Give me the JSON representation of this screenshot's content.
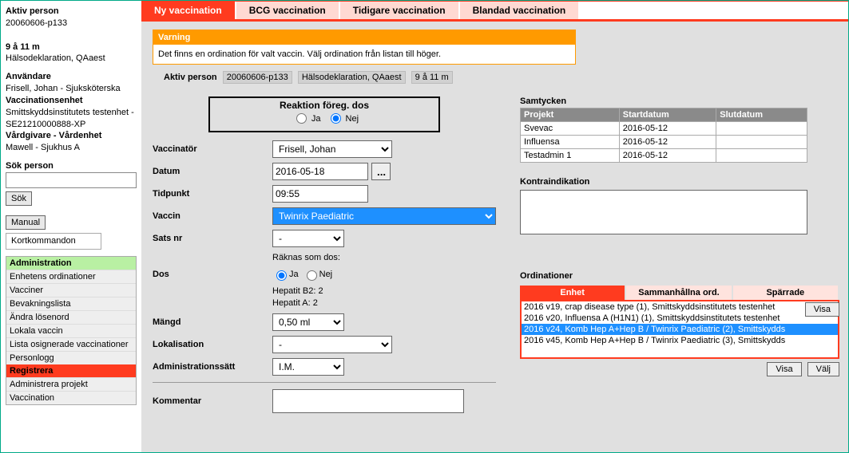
{
  "sidebar": {
    "active_person": {
      "label": "Aktiv person",
      "id": "20060606-p133",
      "age": "9 å 11 m",
      "name": "Hälsodeklaration, QAaest"
    },
    "user": {
      "label": "Användare",
      "name": "Frisell, Johan - Sjuksköterska"
    },
    "unit": {
      "label": "Vaccinationsenhet",
      "name": "Smittskyddsinstitutets testenhet - SE21210000888-XP"
    },
    "care": {
      "label": "Vårdgivare - Vårdenhet",
      "name": "Mawell - Sjukhus A"
    },
    "search": {
      "label": "Sök person",
      "button": "Sök"
    },
    "manual": "Manual",
    "shortcuts": "Kortkommandon"
  },
  "menu": {
    "admin": {
      "title": "Administration",
      "items": [
        "Enhetens ordinationer",
        "Vacciner",
        "Bevakningslista",
        "Ändra lösenord",
        "Lokala vaccin",
        "Lista osignerade vaccinationer",
        "Personlogg"
      ]
    },
    "register": {
      "title": "Registrera",
      "items": [
        "Administrera projekt",
        "Vaccination"
      ]
    }
  },
  "tabs": [
    "Ny vaccination",
    "BCG vaccination",
    "Tidigare vaccination",
    "Blandad vaccination"
  ],
  "warning": {
    "title": "Varning",
    "text": "Det finns en ordination för valt vaccin. Välj ordination från listan till höger."
  },
  "context": {
    "label": "Aktiv person",
    "id": "20060606-p133",
    "name": "Hälsodeklaration, QAaest",
    "age": "9 å 11 m"
  },
  "form": {
    "reaction": {
      "label": "Reaktion föreg. dos",
      "yes": "Ja",
      "no": "Nej"
    },
    "vaccinator": {
      "label": "Vaccinatör",
      "value": "Frisell, Johan"
    },
    "date": {
      "label": "Datum",
      "value": "2016-05-18"
    },
    "time": {
      "label": "Tidpunkt",
      "value": "09:55"
    },
    "vaccine": {
      "label": "Vaccin",
      "value": "Twinrix Paediatric"
    },
    "batch": {
      "label": "Sats nr",
      "value": "-"
    },
    "counted_as": {
      "label": "Räknas som dos:"
    },
    "dose": {
      "label": "Dos",
      "yes": "Ja",
      "no": "Nej",
      "info1": "Hepatit B2: 2",
      "info2": "Hepatit A: 2"
    },
    "amount": {
      "label": "Mängd",
      "value": "0,50 ml"
    },
    "localization": {
      "label": "Lokalisation",
      "value": "-"
    },
    "adminroute": {
      "label": "Administrationssätt",
      "value": "I.M."
    },
    "comment": {
      "label": "Kommentar"
    }
  },
  "consents": {
    "title": "Samtycken",
    "cols": [
      "Projekt",
      "Startdatum",
      "Slutdatum"
    ],
    "rows": [
      {
        "project": "Svevac",
        "start": "2016-05-12"
      },
      {
        "project": "Influensa",
        "start": "2016-05-12"
      },
      {
        "project": "Testadmin 1",
        "start": "2016-05-12"
      }
    ]
  },
  "contra": {
    "title": "Kontraindikation",
    "show": "Visa"
  },
  "ord": {
    "title": "Ordinationer",
    "tabs": [
      "Enhet",
      "Sammanhållna ord.",
      "Spärrade"
    ],
    "rows": [
      "2016 v19, crap disease type (1), Smittskyddsinstitutets testenhet",
      "2016 v20, Influensa A (H1N1) (1), Smittskyddsinstitutets testenhet",
      "2016 v24, Komb Hep A+Hep B / Twinrix Paediatric (2), Smittskydds",
      "2016 v45, Komb Hep A+Hep B / Twinrix Paediatric (3), Smittskydds"
    ],
    "show": "Visa",
    "select": "Välj"
  }
}
